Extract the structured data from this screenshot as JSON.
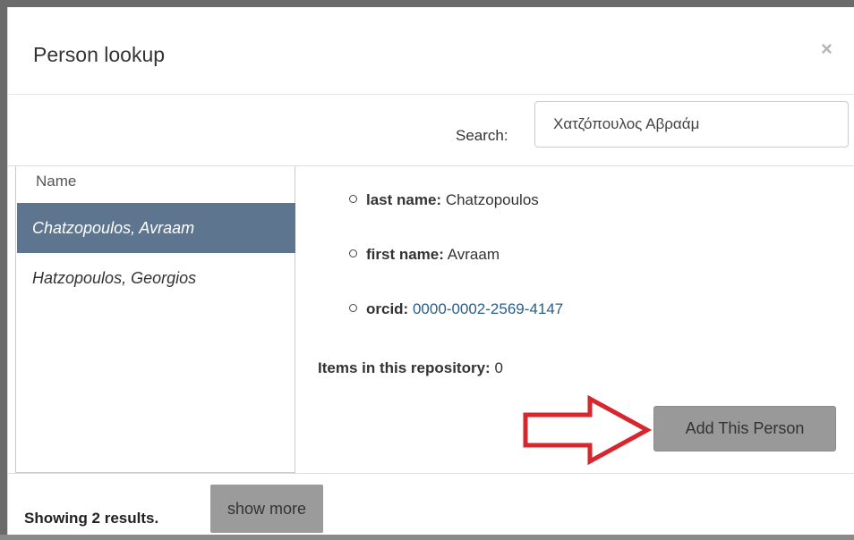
{
  "dialog": {
    "title": "Person lookup",
    "close_glyph": "×"
  },
  "search": {
    "label": "Search:",
    "value": "Χατζόπουλος Αβραάμ"
  },
  "list": {
    "header": "Name",
    "items": [
      {
        "label": "Chatzopoulos, Avraam",
        "selected": true
      },
      {
        "label": "Hatzopoulos, Georgios",
        "selected": false
      }
    ]
  },
  "details": {
    "last_name_label": "last name:",
    "last_name_value": "Chatzopoulos",
    "first_name_label": "first name:",
    "first_name_value": "Avraam",
    "orcid_label": "orcid:",
    "orcid_value": "0000-0002-2569-4147",
    "items_label": "Items in this repository:",
    "items_value": "0"
  },
  "actions": {
    "add_label": "Add This Person"
  },
  "footer": {
    "results_text": "Showing 2 results.",
    "show_more_label": "show more"
  },
  "colors": {
    "selected_row": "#5e758f",
    "arrow": "#d8262e",
    "link": "#2a5d8a",
    "button_gray": "#999999"
  },
  "icons": [
    "close-icon",
    "bullet-icon",
    "arrow-annotation-icon"
  ]
}
